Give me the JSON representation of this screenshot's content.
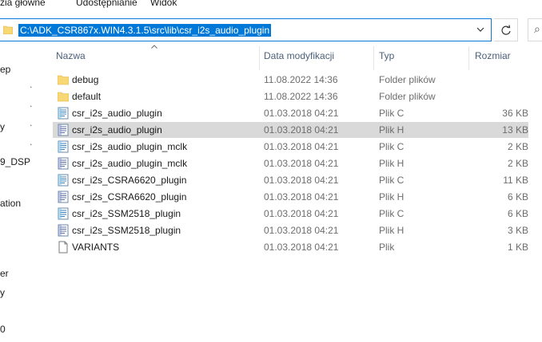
{
  "ribbon": {
    "tabs": [
      "zia główne",
      "Udostępnianie",
      "Widok"
    ]
  },
  "address_bar": {
    "path": "C:\\ADK_CSR867x.WIN4.3.1.5\\src\\lib\\csr_i2s_audio_plugin"
  },
  "nav_pane": {
    "items": [
      "ep",
      "y",
      "9_DSP",
      "ation",
      "er",
      "y",
      "0"
    ]
  },
  "columns": {
    "name": "Nazwa",
    "date": "Data modyfikacji",
    "type": "Typ",
    "size": "Rozmiar"
  },
  "files": [
    {
      "name": "debug",
      "date": "11.08.2022 14:36",
      "type": "Folder plików",
      "size": "",
      "icon": "folder-icon"
    },
    {
      "name": "default",
      "date": "11.08.2022 14:36",
      "type": "Folder plików",
      "size": "",
      "icon": "folder-icon"
    },
    {
      "name": "csr_i2s_audio_plugin",
      "date": "01.03.2018 04:21",
      "type": "Plik C",
      "size": "36 KB",
      "icon": "c-file-icon"
    },
    {
      "name": "csr_i2s_audio_plugin",
      "date": "01.03.2018 04:21",
      "type": "Plik H",
      "size": "13 KB",
      "icon": "h-file-icon",
      "selected": true
    },
    {
      "name": "csr_i2s_audio_plugin_mclk",
      "date": "01.03.2018 04:21",
      "type": "Plik C",
      "size": "2 KB",
      "icon": "c-file-icon"
    },
    {
      "name": "csr_i2s_audio_plugin_mclk",
      "date": "01.03.2018 04:21",
      "type": "Plik H",
      "size": "2 KB",
      "icon": "h-file-icon"
    },
    {
      "name": "csr_i2s_CSRA6620_plugin",
      "date": "01.03.2018 04:21",
      "type": "Plik C",
      "size": "11 KB",
      "icon": "c-file-icon"
    },
    {
      "name": "csr_i2s_CSRA6620_plugin",
      "date": "01.03.2018 04:21",
      "type": "Plik H",
      "size": "6 KB",
      "icon": "h-file-icon"
    },
    {
      "name": "csr_i2s_SSM2518_plugin",
      "date": "01.03.2018 04:21",
      "type": "Plik C",
      "size": "6 KB",
      "icon": "c-file-icon"
    },
    {
      "name": "csr_i2s_SSM2518_plugin",
      "date": "01.03.2018 04:21",
      "type": "Plik H",
      "size": "3 KB",
      "icon": "h-file-icon"
    },
    {
      "name": "VARIANTS",
      "date": "01.03.2018 04:21",
      "type": "Plik",
      "size": "1 KB",
      "icon": "blank-file-icon"
    }
  ],
  "colors": {
    "accent": "#0078d7",
    "selection": "#d9d9d9",
    "folder": "#f8d775"
  }
}
